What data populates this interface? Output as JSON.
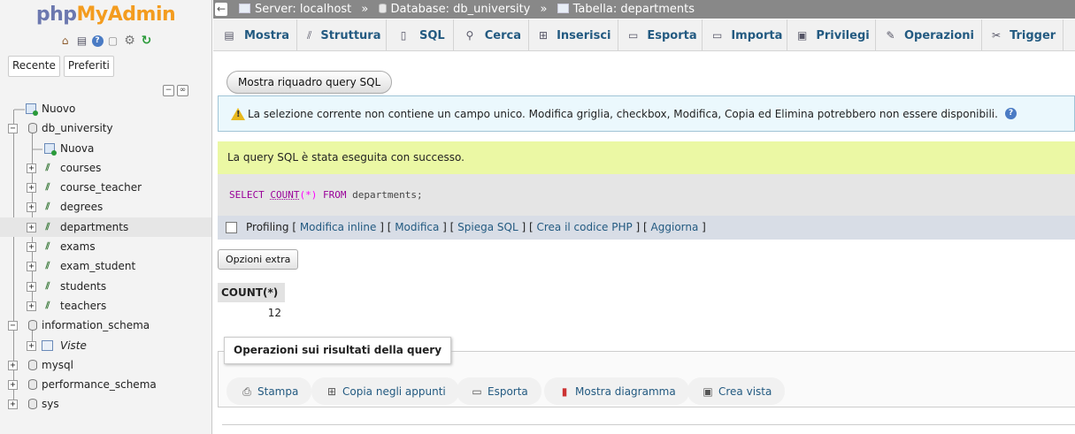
{
  "nav": {
    "logo_php": "php",
    "logo_rest": "MyAdmin",
    "icons": [
      "home-icon",
      "exit-icon",
      "help-icon",
      "docs-icon",
      "settings-icon",
      "reload-icon"
    ],
    "tabs": [
      "Recente",
      "Preferiti"
    ],
    "tree": {
      "new_root": "Nuovo",
      "db_university": "db_university",
      "new_table": "Nuova",
      "tables": [
        "courses",
        "course_teacher",
        "degrees",
        "departments",
        "exams",
        "exam_student",
        "students",
        "teachers"
      ],
      "selected": "departments",
      "information_schema": "information_schema",
      "views": "Viste",
      "mysql": "mysql",
      "performance_schema": "performance_schema",
      "sys": "sys"
    }
  },
  "breadcrumb": {
    "server": "Server: localhost",
    "database": "Database: db_university",
    "table": "Tabella: departments",
    "separator": "»"
  },
  "tabs": [
    {
      "label": "Mostra",
      "icon": "browse-icon"
    },
    {
      "label": "Struttura",
      "icon": "structure-icon"
    },
    {
      "label": "SQL",
      "icon": "sql-icon"
    },
    {
      "label": "Cerca",
      "icon": "search-icon"
    },
    {
      "label": "Inserisci",
      "icon": "insert-icon"
    },
    {
      "label": "Esporta",
      "icon": "export-icon"
    },
    {
      "label": "Importa",
      "icon": "import-icon"
    },
    {
      "label": "Privilegi",
      "icon": "privileges-icon"
    },
    {
      "label": "Operazioni",
      "icon": "operations-icon"
    },
    {
      "label": "Trigger",
      "icon": "trigger-icon"
    }
  ],
  "show_query_button": "Mostra riquadro query SQL",
  "notice": "La selezione corrente non contiene un campo unico. Modifica griglia, checkbox, Modifica, Copia ed Elimina potrebbero non essere disponibili.",
  "success": "La query SQL è stata eseguita con successo.",
  "sql": {
    "select": "SELECT",
    "count": "COUNT",
    "open": "(",
    "star": "*",
    "close": ")",
    "from": "FROM",
    "table": "departments;"
  },
  "profiling": {
    "label": "Profiling",
    "links": [
      "Modifica inline",
      "Modifica",
      "Spiega SQL",
      "Crea il codice PHP",
      "Aggiorna"
    ]
  },
  "extra_options_button": "Opzioni extra",
  "result": {
    "header": "COUNT(*)",
    "value": "12"
  },
  "query_ops": {
    "legend": "Operazioni sui risultati della query",
    "buttons": [
      {
        "label": "Stampa",
        "icon": "print-icon"
      },
      {
        "label": "Copia negli appunti",
        "icon": "clipboard-icon"
      },
      {
        "label": "Esporta",
        "icon": "export-icon"
      },
      {
        "label": "Mostra diagramma",
        "icon": "chart-icon"
      },
      {
        "label": "Crea vista",
        "icon": "create-view-icon"
      }
    ]
  }
}
